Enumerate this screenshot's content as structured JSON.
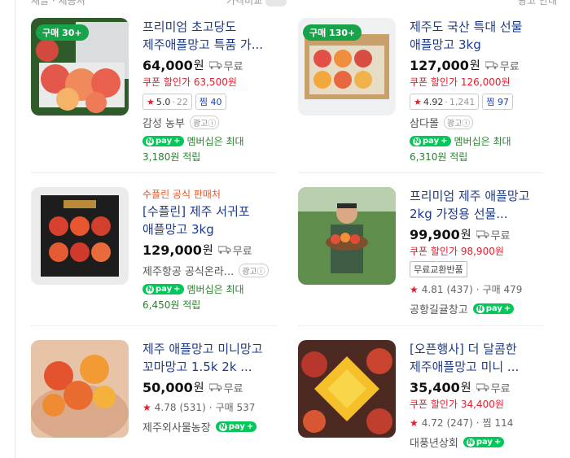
{
  "topbar": {
    "left": "새글 · 제공처",
    "mid": "가격비교",
    "right": "광고 안내"
  },
  "cards": [
    {
      "id": "p1",
      "badge": "구매 30+",
      "seller_tag": "",
      "title": "프리미엄 초고당도 제주애플망고 특품 가...",
      "price": "64,000",
      "won": "원",
      "shipping": "무료",
      "coupon_label": "쿠폰 할인가",
      "coupon_price": "63,500원",
      "rating": "5.0",
      "reviews": "22",
      "zzim_label": "찜",
      "zzim": "40",
      "store": "감성 농부",
      "ad": "광고ⓘ",
      "npay_text": "멤버십은 최대",
      "points": "3,180원 적립"
    },
    {
      "id": "p2",
      "badge": "구매 130+",
      "seller_tag": "",
      "title": "제주도 국산 특대 선물 애플망고 3kg",
      "price": "127,000",
      "won": "원",
      "shipping": "무료",
      "coupon_label": "쿠폰 할인가",
      "coupon_price": "126,000원",
      "rating": "4.92",
      "reviews": "1,241",
      "zzim_label": "찜",
      "zzim": "97",
      "store": "삼다몰",
      "ad": "광고ⓘ",
      "npay_text": "멤버십은 최대",
      "points": "6,310원 적립"
    },
    {
      "id": "p3",
      "badge": "",
      "seller_tag": "수플린 공식 판매처",
      "title": "[수플린] 제주 서귀포 애플망고 3kg",
      "price": "129,000",
      "won": "원",
      "shipping": "무료",
      "store": "제주항공 공식온라...",
      "ad": "광고ⓘ",
      "npay_text": "멤버십은 최대",
      "points": "6,450원 적립"
    },
    {
      "id": "p4",
      "badge": "",
      "seller_tag": "",
      "title": "프리미엄 제주 애플망고 2kg 가정용 선물...",
      "price": "99,900",
      "won": "원",
      "shipping": "무료",
      "coupon_label": "쿠폰 할인가",
      "coupon_price": "98,900원",
      "tag": "무료교환반품",
      "rating": "4.81",
      "reviews": "(437)",
      "extra": "구매 479",
      "store": "공항길귤창고"
    },
    {
      "id": "p5",
      "badge": "",
      "seller_tag": "",
      "title": "제주 애플망고 미니망고 꼬마망고 1.5k 2k ...",
      "price": "50,000",
      "won": "원",
      "shipping": "무료",
      "rating": "4.78",
      "reviews": "(531)",
      "extra": "구매 537",
      "store": "제주외사물농장"
    },
    {
      "id": "p6",
      "badge": "",
      "seller_tag": "",
      "title": "[오픈행사] 더 달콤한 제주애플망고 미니 ...",
      "price": "35,400",
      "won": "원",
      "shipping": "무료",
      "coupon_label": "쿠폰 할인가",
      "coupon_price": "34,400원",
      "rating": "4.72",
      "reviews": "(247)",
      "extra": "찜 114",
      "store": "대풍년상회"
    }
  ],
  "npay_label": "pay",
  "npay_plus": "+",
  "colors": {
    "green": "#03c75a",
    "red": "#e11d2e",
    "blue_title": "#1e3a8a"
  }
}
